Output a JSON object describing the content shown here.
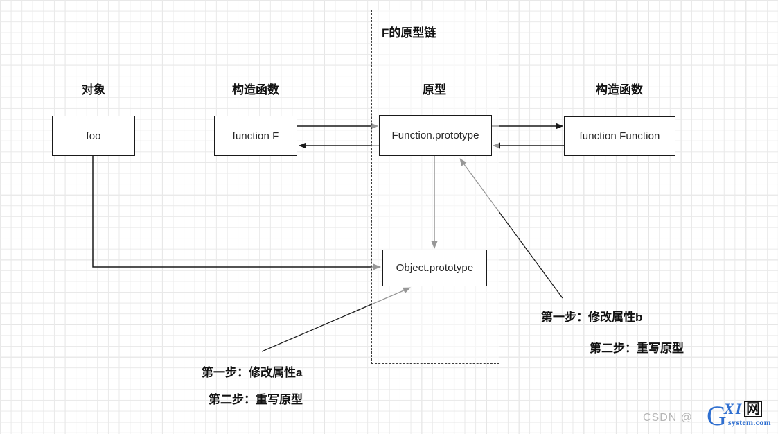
{
  "diagram": {
    "group": {
      "title": "F的原型链"
    },
    "column_headers": [
      {
        "label": "对象"
      },
      {
        "label": "构造函数"
      },
      {
        "label": "原型"
      },
      {
        "label": "构造函数"
      }
    ],
    "nodes": [
      {
        "id": "foo",
        "label": "foo"
      },
      {
        "id": "function-f",
        "label": "function F"
      },
      {
        "id": "function-prototype",
        "label": "Function.prototype"
      },
      {
        "id": "function-function",
        "label": "function Function"
      },
      {
        "id": "object-prototype",
        "label": "Object.prototype"
      }
    ],
    "annotations": [
      {
        "id": "note-a",
        "line1": "第一步：修改属性a",
        "line2": "第二步：重写原型"
      },
      {
        "id": "note-b",
        "line1": "第一步：修改属性b",
        "line2": "第二步：重写原型"
      }
    ],
    "edges": [
      {
        "from": "function-f",
        "to": "function-prototype",
        "direction": "right"
      },
      {
        "from": "function-prototype",
        "to": "function-f",
        "direction": "left"
      },
      {
        "from": "function-prototype",
        "to": "function-function",
        "direction": "right"
      },
      {
        "from": "function-function",
        "to": "function-prototype",
        "direction": "left"
      },
      {
        "from": "function-prototype",
        "to": "object-prototype",
        "direction": "down"
      },
      {
        "from": "foo",
        "to": "object-prototype",
        "direction": "right"
      },
      {
        "from": "note-a",
        "to": "object-prototype",
        "direction": "up-right"
      },
      {
        "from": "note-b",
        "to": "function-prototype",
        "direction": "up-left"
      }
    ]
  },
  "watermark": {
    "csdn": "CSDN @",
    "logo_letter": "G",
    "logo_xi": "XI",
    "logo_wang": "网",
    "logo_sub": "system.com"
  },
  "colors": {
    "stroke": "#1a1a1a",
    "grid_minor": "#e9e9e9",
    "grid_major": "#dcdcdc",
    "text": "#111111",
    "watermark": "#b6b6b6",
    "logo_blue": "#2f6fd0"
  }
}
